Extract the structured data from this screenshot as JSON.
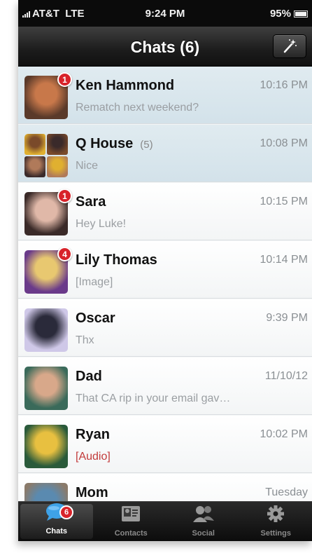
{
  "status_bar": {
    "carrier": "AT&T",
    "network": "LTE",
    "time": "9:24 PM",
    "battery": "95%"
  },
  "nav": {
    "title": "Chats (6)",
    "compose_icon": "magic-wand-icon"
  },
  "chats": [
    {
      "name": "Ken Hammond",
      "time": "10:16 PM",
      "preview": "Rematch next weekend?",
      "badge": "1",
      "unread": true,
      "member_count": "",
      "colors": [
        "#5a3a2a",
        "#c8784a"
      ]
    },
    {
      "name": "Q House",
      "member_count": "(5)",
      "time": "10:08 PM",
      "preview": "Nice",
      "badge": "",
      "unread": true,
      "colors": [
        "#e0b030",
        "#7a4a2a",
        "#3a2a2a",
        "#b07a5a"
      ]
    },
    {
      "name": "Sara",
      "time": "10:15 PM",
      "preview": "Hey Luke!",
      "badge": "1",
      "unread": false,
      "member_count": "",
      "colors": [
        "#3a2a28",
        "#e0b8a8"
      ]
    },
    {
      "name": "Lily Thomas",
      "time": "10:14 PM",
      "preview": "[Image]",
      "badge": "4",
      "unread": false,
      "member_count": "",
      "colors": [
        "#6a3a8a",
        "#e8c870"
      ]
    },
    {
      "name": "Oscar",
      "time": "9:39 PM",
      "preview": "Thx",
      "badge": "",
      "unread": false,
      "member_count": "",
      "colors": [
        "#cfc8e8",
        "#2a2a3a"
      ]
    },
    {
      "name": "Dad",
      "time": "11/10/12",
      "preview": "That CA rip in your email gav…",
      "badge": "",
      "unread": false,
      "member_count": "",
      "colors": [
        "#3a6a5a",
        "#d8a88a"
      ]
    },
    {
      "name": "Ryan",
      "time": "10:02 PM",
      "preview": "[Audio]",
      "badge": "",
      "unread": false,
      "member_count": "",
      "media": true,
      "colors": [
        "#2a5a3a",
        "#e8c040"
      ]
    },
    {
      "name": "Mom",
      "time": "Tuesday",
      "preview": "",
      "badge": "",
      "unread": false,
      "member_count": "",
      "colors": [
        "#8a7a6a",
        "#5a8ab0"
      ]
    }
  ],
  "tabs": [
    {
      "label": "Chats",
      "icon": "chat-bubble-icon",
      "badge": "6",
      "active": true
    },
    {
      "label": "Contacts",
      "icon": "contact-card-icon",
      "badge": "",
      "active": false
    },
    {
      "label": "Social",
      "icon": "people-icon",
      "badge": "",
      "active": false
    },
    {
      "label": "Settings",
      "icon": "gear-icon",
      "badge": "",
      "active": false
    }
  ]
}
